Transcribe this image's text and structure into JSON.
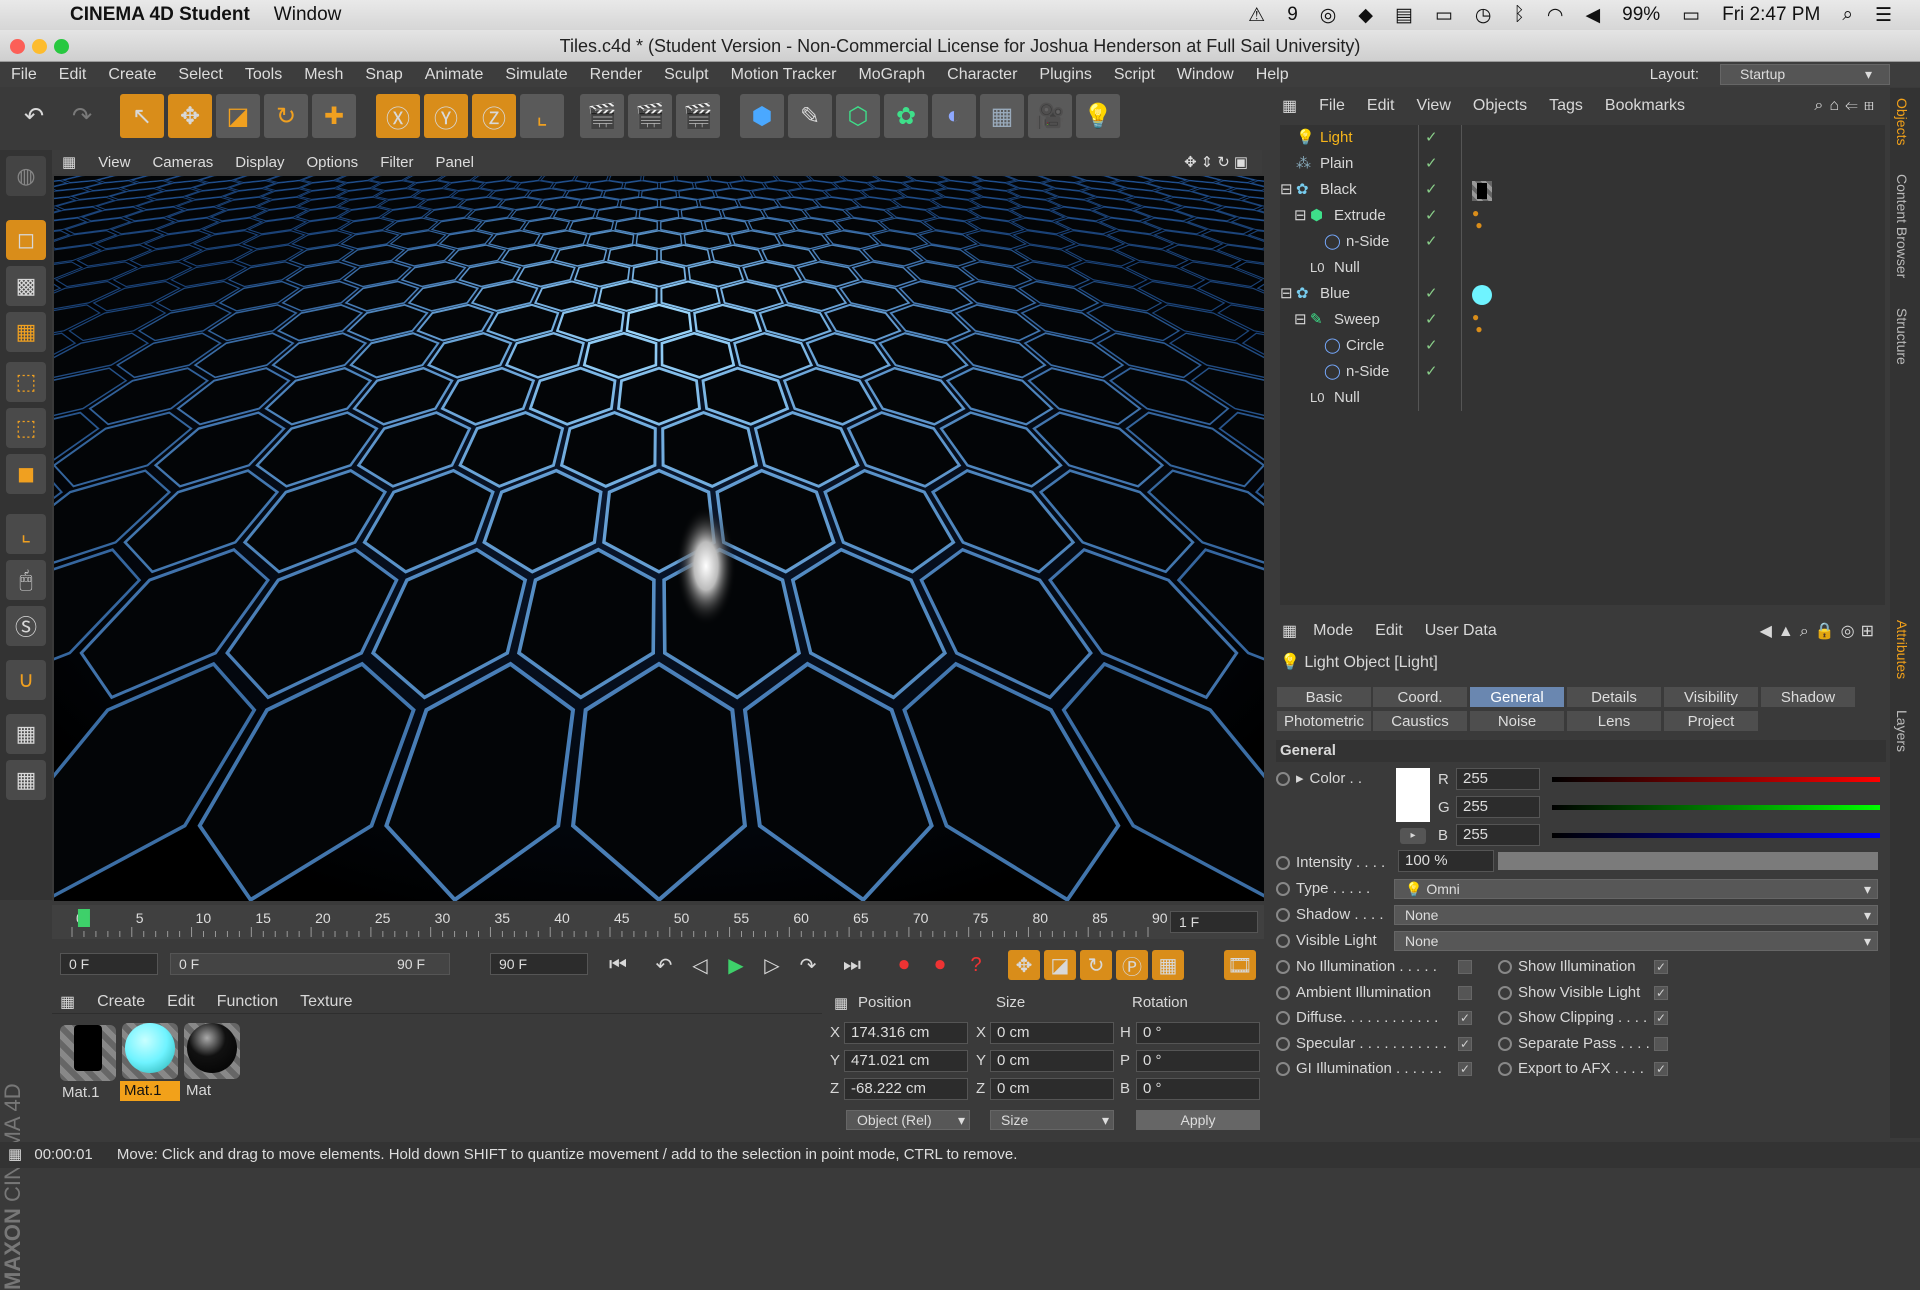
{
  "macbar": {
    "app_name": "CINEMA 4D Student",
    "window_menu": "Window",
    "notif_count": "9",
    "battery": "99%",
    "clock": "Fri 2:47 PM"
  },
  "window": {
    "title": "Tiles.c4d * (Student Version - Non-Commercial License for Joshua Henderson at Full Sail University)"
  },
  "menu": [
    "File",
    "Edit",
    "Create",
    "Select",
    "Tools",
    "Mesh",
    "Snap",
    "Animate",
    "Simulate",
    "Render",
    "Sculpt",
    "Motion Tracker",
    "MoGraph",
    "Character",
    "Plugins",
    "Script",
    "Window",
    "Help"
  ],
  "layout": {
    "label": "Layout:",
    "value": "Startup"
  },
  "viewport": {
    "menu": [
      "View",
      "Cameras",
      "Display",
      "Options",
      "Filter",
      "Panel"
    ],
    "accent": "#2f8cff"
  },
  "timeline": {
    "ticks": [
      "0",
      "5",
      "10",
      "15",
      "20",
      "25",
      "30",
      "35",
      "40",
      "45",
      "50",
      "55",
      "60",
      "65",
      "70",
      "75",
      "80",
      "85",
      "90"
    ],
    "current_frame_field": "1 F",
    "start_field": "0 F",
    "range_start": "0 F",
    "range_end": "90 F",
    "end_field": "90 F"
  },
  "materials": {
    "menu": [
      "Create",
      "Edit",
      "Function",
      "Texture"
    ],
    "items": [
      {
        "label": "Mat.1",
        "color": "#111111",
        "selected": false
      },
      {
        "label": "Mat.1",
        "color": "#6ff3ff",
        "selected": true
      },
      {
        "label": "Mat",
        "color": "#0a0a0a",
        "selected": false
      }
    ]
  },
  "coords": {
    "headers": {
      "position": "Position",
      "size": "Size",
      "rotation": "Rotation"
    },
    "pos": {
      "x": "174.316 cm",
      "y": "471.021 cm",
      "z": "-68.222 cm"
    },
    "size": {
      "x": "0 cm",
      "y": "0 cm",
      "z": "0 cm"
    },
    "rot": {
      "h": "0 °",
      "p": "0 °",
      "b": "0 °"
    },
    "axis_labels": {
      "x": "X",
      "y": "Y",
      "z": "Z",
      "h": "H",
      "p": "P",
      "b": "B"
    },
    "mode_dropdown": "Object (Rel)",
    "size_dropdown": "Size",
    "apply_label": "Apply"
  },
  "status": {
    "time": "00:00:01",
    "message": "Move: Click and drag to move elements. Hold down SHIFT to quantize movement / add to the selection in point mode, CTRL to remove."
  },
  "objects": {
    "menu": [
      "File",
      "Edit",
      "View",
      "Objects",
      "Tags",
      "Bookmarks"
    ],
    "rows": [
      {
        "name": "Light",
        "selected": true
      },
      {
        "name": "Plain"
      },
      {
        "name": "Black"
      },
      {
        "name": "Extrude"
      },
      {
        "name": "n-Side"
      },
      {
        "name": "Null"
      },
      {
        "name": "Blue"
      },
      {
        "name": "Sweep"
      },
      {
        "name": "Circle"
      },
      {
        "name": "n-Side"
      },
      {
        "name": "Null"
      }
    ]
  },
  "attributes": {
    "menu": [
      "Mode",
      "Edit",
      "User Data"
    ],
    "object_title": "Light Object [Light]",
    "tabs_row1": [
      "Basic",
      "Coord.",
      "General",
      "Details",
      "Visibility",
      "Shadow"
    ],
    "tabs_row2": [
      "Photometric",
      "Caustics",
      "Noise",
      "Lens",
      "Project"
    ],
    "active_tab": "General",
    "section": "General",
    "color_label": "Color . .",
    "rgb": {
      "r_label": "R",
      "g_label": "G",
      "b_label": "B",
      "r": "255",
      "g": "255",
      "b": "255"
    },
    "intensity_label": "Intensity . . . .",
    "intensity_value": "100 %",
    "intensity_level": 1.0,
    "type_label": "Type . . . . .",
    "type_value": "Omni",
    "shadow_label": "Shadow . . . .",
    "shadow_value": "None",
    "visible_light_label": "Visible Light",
    "visible_light_value": "None",
    "left_checks": [
      {
        "label": "No Illumination . . . . .",
        "checked": false
      },
      {
        "label": "Ambient Illumination",
        "checked": false
      },
      {
        "label": "Diffuse. . . . . . . . . . . .",
        "checked": true
      },
      {
        "label": "Specular . . . . . . . . . . .",
        "checked": true
      },
      {
        "label": "GI Illumination . . . . . .",
        "checked": true
      }
    ],
    "right_checks": [
      {
        "label": "Show Illumination",
        "checked": true
      },
      {
        "label": "Show Visible Light",
        "checked": true
      },
      {
        "label": "Show Clipping . . . .",
        "checked": true
      },
      {
        "label": "Separate Pass . . . .",
        "checked": false
      },
      {
        "label": "Export to AFX . . . .",
        "checked": true
      }
    ]
  },
  "side_tabs": {
    "objects": "Objects",
    "content": "Content Browser",
    "structure": "Structure",
    "attributes": "Attributes",
    "layers": "Layers"
  },
  "brand": {
    "logo_line1": "MAXON",
    "logo_line2": "CINEMA 4D"
  }
}
